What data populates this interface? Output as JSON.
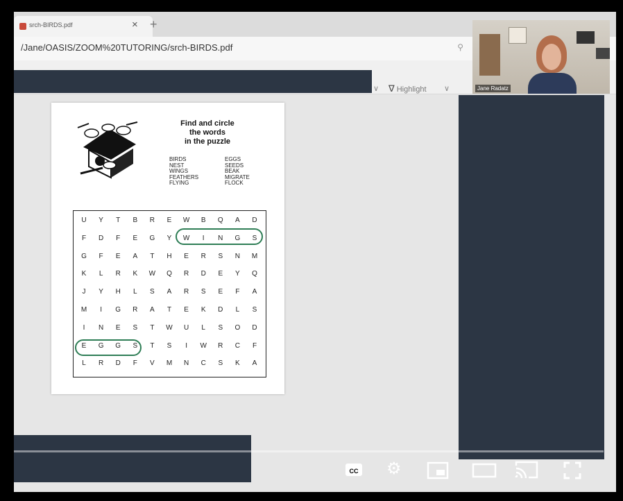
{
  "browser": {
    "tab_title": "srch-BIRDS.pdf",
    "tab_close": "×",
    "new_tab": "+",
    "address": "/Jane/OASIS/ZOOM%20TUTORING/srch-BIRDS.pdf"
  },
  "toolbar": {
    "highlight_label": "Highlight",
    "chevron": "∨"
  },
  "puzzle": {
    "title_lines": [
      "Find and circle",
      "the words",
      "in the puzzle"
    ],
    "words_col1": [
      "BIRDS",
      "NEST",
      "WINGS",
      "FEATHERS",
      "FLYING"
    ],
    "words_col2": [
      "EGGS",
      "SEEDS",
      "BEAK",
      "MIGRATE",
      "FLOCK"
    ],
    "rows": [
      [
        "U",
        "Y",
        "T",
        "B",
        "R",
        "E",
        "W",
        "B",
        "Q",
        "A",
        "D"
      ],
      [
        "F",
        "D",
        "F",
        "E",
        "G",
        "Y",
        "W",
        "I",
        "N",
        "G",
        "S"
      ],
      [
        "G",
        "F",
        "E",
        "A",
        "T",
        "H",
        "E",
        "R",
        "S",
        "N",
        "M"
      ],
      [
        "K",
        "L",
        "R",
        "K",
        "W",
        "Q",
        "R",
        "D",
        "E",
        "Y",
        "Q"
      ],
      [
        "J",
        "Y",
        "H",
        "L",
        "S",
        "A",
        "R",
        "S",
        "E",
        "F",
        "A"
      ],
      [
        "M",
        "I",
        "G",
        "R",
        "A",
        "T",
        "E",
        "K",
        "D",
        "L",
        "S"
      ],
      [
        "I",
        "N",
        "E",
        "S",
        "T",
        "W",
        "U",
        "L",
        "S",
        "O",
        "D"
      ],
      [
        "E",
        "G",
        "G",
        "S",
        "T",
        "S",
        "I",
        "W",
        "R",
        "C",
        "F"
      ],
      [
        "L",
        "R",
        "D",
        "F",
        "V",
        "M",
        "N",
        "C",
        "S",
        "K",
        "A"
      ]
    ],
    "circled": [
      "WINGS",
      "EGGS"
    ]
  },
  "participant": {
    "name": "Jane Radatz"
  },
  "player": {
    "cc_label": "CC",
    "icons": [
      "captions-icon",
      "settings-icon",
      "miniplayer-icon",
      "theater-mode-icon",
      "cast-icon",
      "fullscreen-icon"
    ]
  },
  "colors": {
    "redaction": "#2c3644",
    "circle_ink": "#2e7d55"
  }
}
